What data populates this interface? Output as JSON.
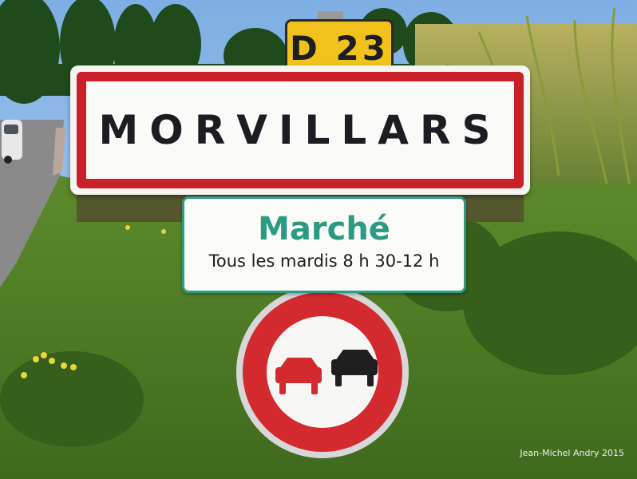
{
  "scene": {
    "d_plate": "D 23",
    "town_name": "MORVILLARS",
    "market_title": "Marché",
    "market_hours": "Tous les mardis 8 h 30-12 h",
    "no_overtaking_sign": "no-overtaking-icon"
  },
  "credit": "Jean-Michel Andry 2015",
  "colors": {
    "sign_red": "#c9202a",
    "plate_yellow": "#f2c21c",
    "market_green": "#2a9a80",
    "grass": "#5f8e2e",
    "sky": "#8fb8e8"
  }
}
